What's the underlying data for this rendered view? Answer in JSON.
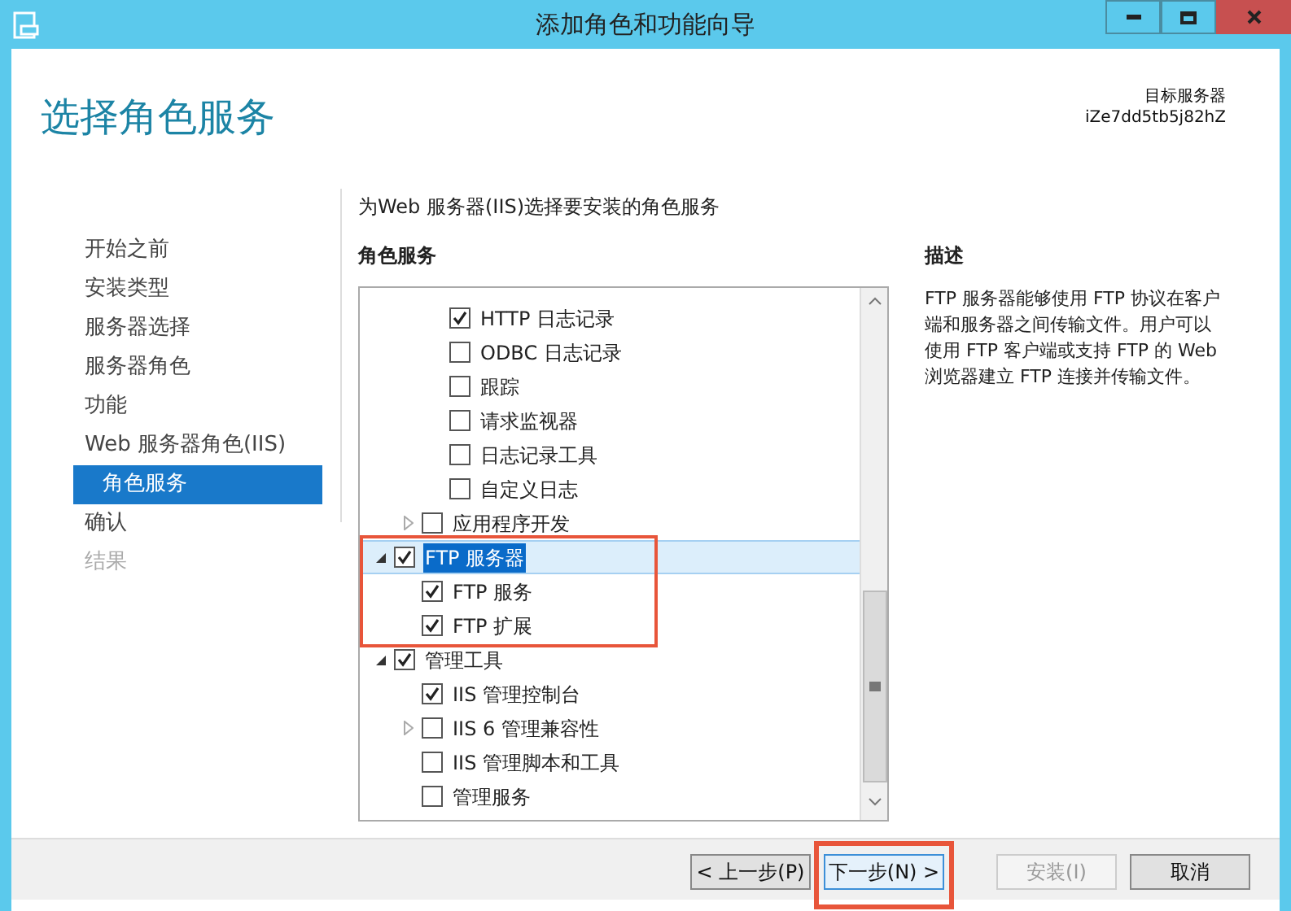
{
  "window": {
    "title": "添加角色和功能向导"
  },
  "header": {
    "title": "选择角色服务",
    "target_label": "目标服务器",
    "target_server": "iZe7dd5tb5j82hZ"
  },
  "nav": [
    {
      "label": "开始之前",
      "selected": false,
      "disabled": false
    },
    {
      "label": "安装类型",
      "selected": false,
      "disabled": false
    },
    {
      "label": "服务器选择",
      "selected": false,
      "disabled": false
    },
    {
      "label": "服务器角色",
      "selected": false,
      "disabled": false
    },
    {
      "label": "功能",
      "selected": false,
      "disabled": false
    },
    {
      "label": "Web 服务器角色(IIS)",
      "selected": false,
      "disabled": false,
      "children": [
        {
          "label": "角色服务",
          "selected": true,
          "disabled": false
        }
      ]
    },
    {
      "label": "确认",
      "selected": false,
      "disabled": false
    },
    {
      "label": "结果",
      "selected": false,
      "disabled": true
    }
  ],
  "intro": "为Web 服务器(IIS)选择要安装的角色服务",
  "role_services": {
    "heading": "角色服务",
    "items": [
      {
        "children": [
          {
            "children": [
              {
                "label": "HTTP 日志记录",
                "checked": true,
                "selected": false
              },
              {
                "label": "ODBC 日志记录",
                "checked": false,
                "selected": false
              },
              {
                "label": "跟踪",
                "checked": false,
                "selected": false
              },
              {
                "label": "请求监视器",
                "checked": false,
                "selected": false
              },
              {
                "label": "日志记录工具",
                "checked": false,
                "selected": false
              },
              {
                "label": "自定义日志",
                "checked": false,
                "selected": false
              }
            ]
          },
          {
            "label": "应用程序开发",
            "checked": false,
            "expanded": false,
            "selected": false
          }
        ]
      },
      {
        "label": "FTP 服务器",
        "checked": true,
        "expanded": true,
        "selected": true,
        "annotated": true,
        "children": [
          {
            "label": "FTP 服务",
            "checked": true,
            "selected": false
          },
          {
            "label": "FTP 扩展",
            "checked": true,
            "selected": false
          }
        ]
      },
      {
        "label": "管理工具",
        "checked": true,
        "expanded": true,
        "selected": false,
        "children": [
          {
            "label": "IIS 管理控制台",
            "checked": true,
            "selected": false
          },
          {
            "label": "IIS 6 管理兼容性",
            "checked": false,
            "expanded": false,
            "selected": false
          },
          {
            "label": "IIS 管理脚本和工具",
            "checked": false,
            "selected": false
          },
          {
            "label": "管理服务",
            "checked": false,
            "selected": false
          }
        ]
      }
    ]
  },
  "description": {
    "heading": "描述",
    "text": "FTP 服务器能够使用 FTP 协议在客户端和服务器之间传输文件。用户可以使用 FTP 客户端或支持 FTP 的 Web 浏览器建立 FTP 连接并传输文件。"
  },
  "buttons": [
    {
      "label": "< 上一步(P)",
      "disabled": false,
      "focused": false,
      "annotated": false
    },
    {
      "label": "下一步(N) >",
      "disabled": false,
      "focused": true,
      "annotated": true
    },
    {
      "label": "安装(I)",
      "disabled": true,
      "focused": false,
      "annotated": false
    },
    {
      "label": "取消",
      "disabled": false,
      "focused": false,
      "annotated": false
    }
  ]
}
